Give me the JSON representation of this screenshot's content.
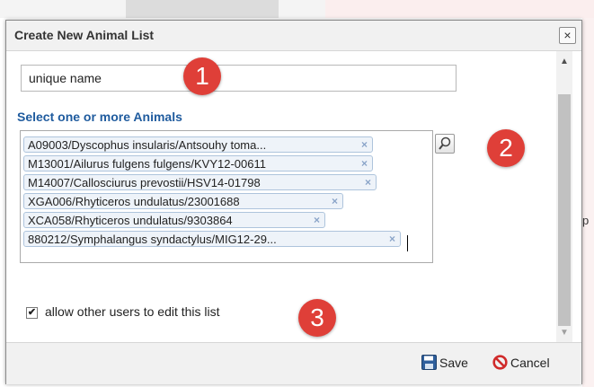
{
  "background": {
    "right_fragment": "p"
  },
  "dialog": {
    "title": "Create New Animal List",
    "close_glyph": "×"
  },
  "name_field": {
    "value": "unique name"
  },
  "animals": {
    "label": "Select one or more Animals",
    "selected": [
      {
        "text": "A09003/Dyscophus insularis/Antsouhy toma..."
      },
      {
        "text": "M13001/Ailurus fulgens fulgens/KVY12-00611"
      },
      {
        "text": "M14007/Callosciurus prevostii/HSV14-01798"
      },
      {
        "text": "XGA006/Rhyticeros undulatus/23001688"
      },
      {
        "text": "XCA058/Rhyticeros undulatus/9303864"
      },
      {
        "text": "880212/Symphalangus syndactylus/MIG12-29..."
      }
    ],
    "remove_glyph": "×",
    "lookup_icon": "search-icon"
  },
  "allow_edit": {
    "label": "allow other users to edit this list",
    "checked": true,
    "glyph": "✔"
  },
  "footer": {
    "save_label": "Save",
    "cancel_label": "Cancel",
    "save_icon": "floppy-disk-icon",
    "cancel_icon": "cancel-icon"
  },
  "callouts": {
    "one": "1",
    "two": "2",
    "three": "3"
  },
  "colors": {
    "label_blue": "#1f5b9e",
    "callout_red": "#df3f38",
    "tag_bg": "#eef3f9"
  }
}
